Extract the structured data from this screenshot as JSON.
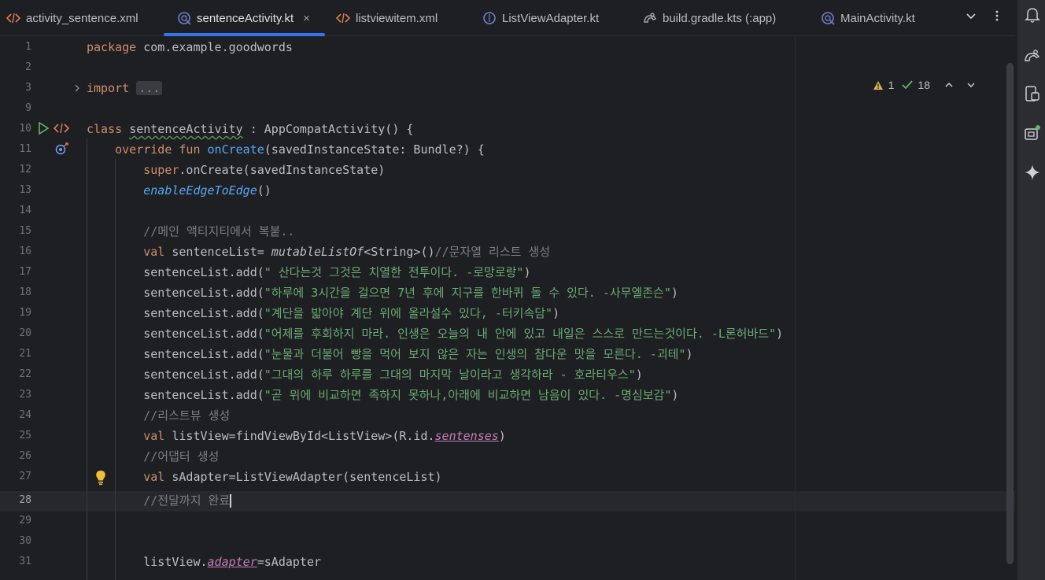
{
  "tabs": [
    {
      "label": "activity_sentence.xml",
      "icon": "xml-icon",
      "active": false
    },
    {
      "label": "sentenceActivity.kt",
      "icon": "kotlin-activity-icon",
      "active": true
    },
    {
      "label": "listviewitem.xml",
      "icon": "xml-icon",
      "active": false
    },
    {
      "label": "ListViewAdapter.kt",
      "icon": "kotlin-class-icon",
      "active": false
    },
    {
      "label": "build.gradle.kts (:app)",
      "icon": "gradle-icon",
      "active": false
    },
    {
      "label": "MainActivity.kt",
      "icon": "kotlin-activity-icon",
      "active": false
    }
  ],
  "close_glyph": "×",
  "inspection": {
    "warnings": "1",
    "checks": "18"
  },
  "line_numbers": [
    "1",
    "2",
    "3",
    "9",
    "10",
    "11",
    "12",
    "13",
    "14",
    "15",
    "16",
    "17",
    "18",
    "19",
    "20",
    "21",
    "22",
    "23",
    "24",
    "25",
    "26",
    "27",
    "28",
    "29",
    "30",
    "31"
  ],
  "code": {
    "l1_kw": "package",
    "l1_rest": " com.example.goodwords",
    "l3_kw": "import",
    "l3_fold": "...",
    "l10_kw": "class",
    "l10_name": "sentenceActivity",
    "l10_rest": " : AppCompatActivity() {",
    "l11_kw": "override fun",
    "l11_fn": "onCreate",
    "l11_rest": "(savedInstanceState: Bundle?) {",
    "l12_kw": "super",
    "l12_rest": ".onCreate(savedInstanceState)",
    "l13_fn": "enableEdgeToEdge",
    "l13_rest": "()",
    "l15_cmt": "//메인 액티지티에서 복붙..",
    "l16_kw": "val",
    "l16_a": " sentenceList= ",
    "l16_fn": "mutableListOf",
    "l16_b": "<String>()",
    "l16_cmt": "//문자열 리스트 생성",
    "l17_a": "sentenceList.add(",
    "l17_str": "\" 산다는것 그것은 치열한 전투이다. -로망로랑\"",
    "l17_b": ")",
    "l18_a": "sentenceList.add(",
    "l18_str": "\"하루에 3시간을 걸으면 7년 후에 지구를 한바퀴 돌 수 있다. -사무엘존슨\"",
    "l18_b": ")",
    "l19_a": "sentenceList.add(",
    "l19_str": "\"계단을 밟아야 계단 위에 올라설수 있다, -터키속담\"",
    "l19_b": ")",
    "l20_a": "sentenceList.add(",
    "l20_str": "\"어제를 후회하지 마라. 인생은 오늘의 내 안에 있고 내일은 스스로 만드는것이다. -L론허바드\"",
    "l20_b": ")",
    "l21_a": "sentenceList.add(",
    "l21_str": "\"눈물과 더불어 빵을 먹어 보지 않은 자는 인생의 참다운 맛을 모른다. -괴테\"",
    "l21_b": ")",
    "l22_a": "sentenceList.add(",
    "l22_str": "\"그대의 하루 하루를 그대의 마지막 날이라고 생각하라 - 호라티우스\"",
    "l22_b": ")",
    "l23_a": "sentenceList.add(",
    "l23_str": "\"곧 위에 비교하면 족하지 못하나,아래에 비교하면 남음이 있다. -명심보감\"",
    "l23_b": ")",
    "l24_cmt": "//리스트뷰 생성",
    "l25_kw": "val",
    "l25_a": " listView=findViewById<ListView>(R.id.",
    "l25_prop": "sentenses",
    "l25_b": ")",
    "l26_cmt": "//어댑터 생성",
    "l27_kw": "val",
    "l27_a": " sAdapter=ListViewAdapter(sentenceList)",
    "l28_cmt": "//전달까지 완료",
    "l31_a": "listView.",
    "l31_prop": "adapter",
    "l31_b": "=sAdapter"
  },
  "colors": {
    "keyword": "#cf8e6d",
    "function": "#56a8f5",
    "string": "#6aab73",
    "comment": "#7a7e85",
    "property": "#c77dbb",
    "accent": "#3574f0"
  },
  "right_toolbar": [
    "notifications-icon",
    "gradle-icon",
    "device-manager-icon",
    "running-devices-icon",
    "gemini-icon"
  ]
}
